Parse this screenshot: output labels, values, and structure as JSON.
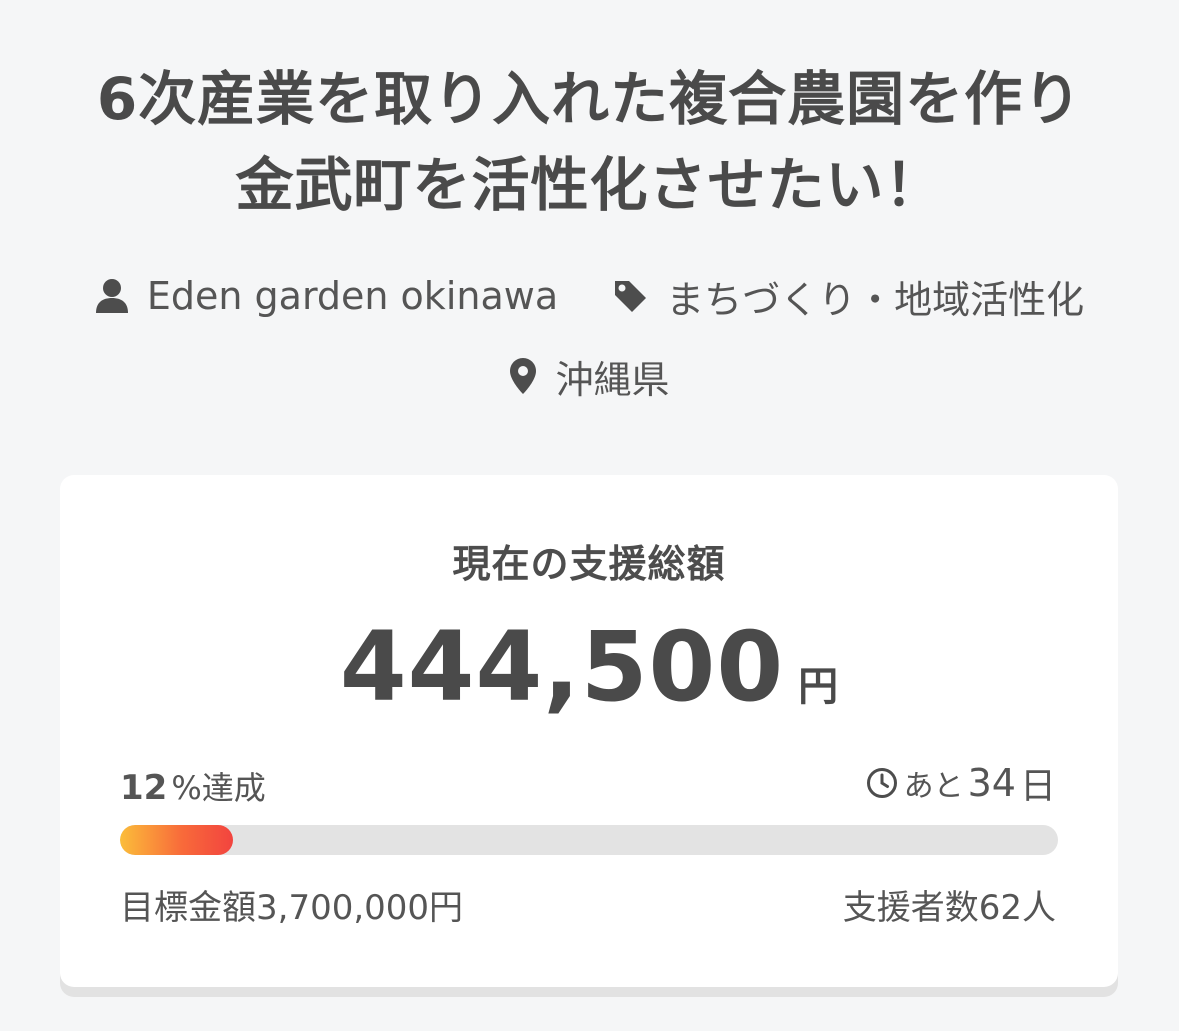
{
  "project": {
    "title_line1": "6次産業を取り入れた複合農園を作り",
    "title_line2": "金武町を活性化させたい！",
    "owner": "Eden garden okinawa",
    "category": "まちづくり・地域活性化",
    "location": "沖縄県"
  },
  "funding": {
    "label": "現在の支援総額",
    "amount": "444,500",
    "amount_unit": "円",
    "achieved_percent": "12",
    "achieved_suffix": "%達成",
    "progress_fraction": 0.12,
    "remaining_prefix": "あと",
    "remaining_days": "34",
    "remaining_unit": "日",
    "goal_text": "目標金額3,700,000円",
    "backers_text": "支援者数62人"
  },
  "icons": {
    "owner": "person-icon",
    "category": "tag-icon",
    "location": "map-pin-icon",
    "remaining": "clock-icon"
  },
  "colors": {
    "progress_start": "#fbbd3a",
    "progress_end": "#f2443f",
    "track": "#e3e3e3"
  }
}
